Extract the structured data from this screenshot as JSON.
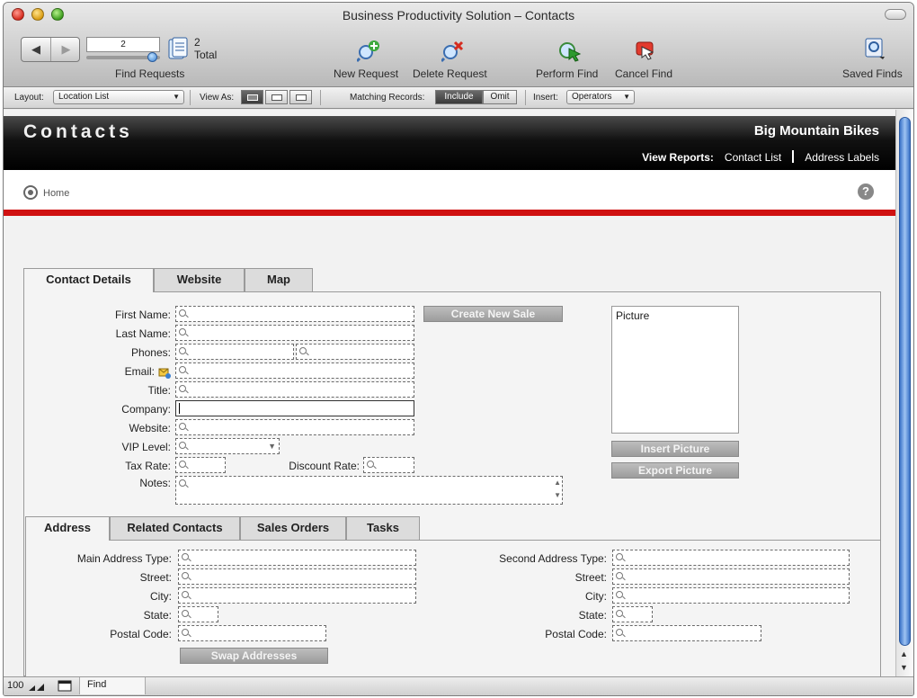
{
  "window": {
    "title": "Business Productivity Solution – Contacts"
  },
  "toolbar": {
    "record_number": "2",
    "total_count": "2",
    "total_label": "Total",
    "find_requests_label": "Find Requests",
    "new_request_label": "New Request",
    "delete_request_label": "Delete Request",
    "perform_find_label": "Perform Find",
    "cancel_find_label": "Cancel Find",
    "saved_finds_label": "Saved Finds"
  },
  "statusbar": {
    "layout_label": "Layout:",
    "layout_value": "Location List",
    "view_as_label": "View As:",
    "matching_label": "Matching Records:",
    "include_label": "Include",
    "omit_label": "Omit",
    "insert_label": "Insert:",
    "operators_label": "Operators"
  },
  "header": {
    "title": "Contacts",
    "company": "Big Mountain Bikes",
    "view_reports_label": "View Reports:",
    "contact_list_link": "Contact List",
    "address_labels_link": "Address Labels"
  },
  "nav": {
    "home_label": "Home",
    "help_glyph": "?"
  },
  "top_tabs": [
    "Contact Details",
    "Website",
    "Map"
  ],
  "contact_form": {
    "first_name": "First Name:",
    "last_name": "Last Name:",
    "phones": "Phones:",
    "email": "Email:",
    "title": "Title:",
    "company": "Company:",
    "website": "Website:",
    "vip_level": "VIP Level:",
    "tax_rate": "Tax Rate:",
    "discount_rate": "Discount Rate:",
    "notes": "Notes:",
    "create_new_sale": "Create New Sale",
    "picture_label": "Picture",
    "insert_picture": "Insert Picture",
    "export_picture": "Export Picture"
  },
  "bottom_tabs": [
    "Address",
    "Related Contacts",
    "Sales Orders",
    "Tasks"
  ],
  "address_form": {
    "main_address_type": "Main Address Type:",
    "second_address_type": "Second Address Type:",
    "street": "Street:",
    "city": "City:",
    "state": "State:",
    "postal_code": "Postal Code:",
    "swap_addresses": "Swap Addresses"
  },
  "bottombar": {
    "zoom": "100",
    "mode": "Find"
  },
  "colors": {
    "accent_red": "#d01212",
    "header_black": "#000000",
    "button_gray": "#a8a8a8",
    "scroll_blue": "#3b73c8"
  }
}
